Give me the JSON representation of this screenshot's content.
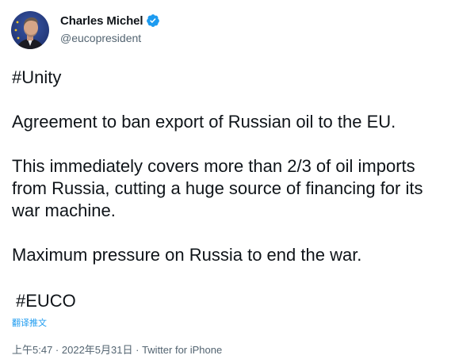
{
  "author": {
    "display_name": "Charles Michel",
    "handle": "@eucopresident",
    "verified_icon": "verified-badge-icon",
    "avatar_icon": "profile-photo"
  },
  "tweet": {
    "hashtag_top": "#Unity",
    "line1": "Agreement to ban export of Russian oil to the EU.",
    "para2": "This immediately covers more than 2/3 of oil imports\nfrom Russia, cutting a huge source of financing for its\nwar machine.",
    "line4": "Maximum pressure on Russia to end the war.",
    "hashtag_bottom": "#EUCO"
  },
  "translate_label": "翻译推文",
  "meta": {
    "time": "上午5:47",
    "separator": " · ",
    "date": "2022年5月31日",
    "source": "Twitter for iPhone"
  },
  "colors": {
    "link": "#1d9bf0",
    "text": "#0f1419",
    "secondary": "#536471"
  }
}
